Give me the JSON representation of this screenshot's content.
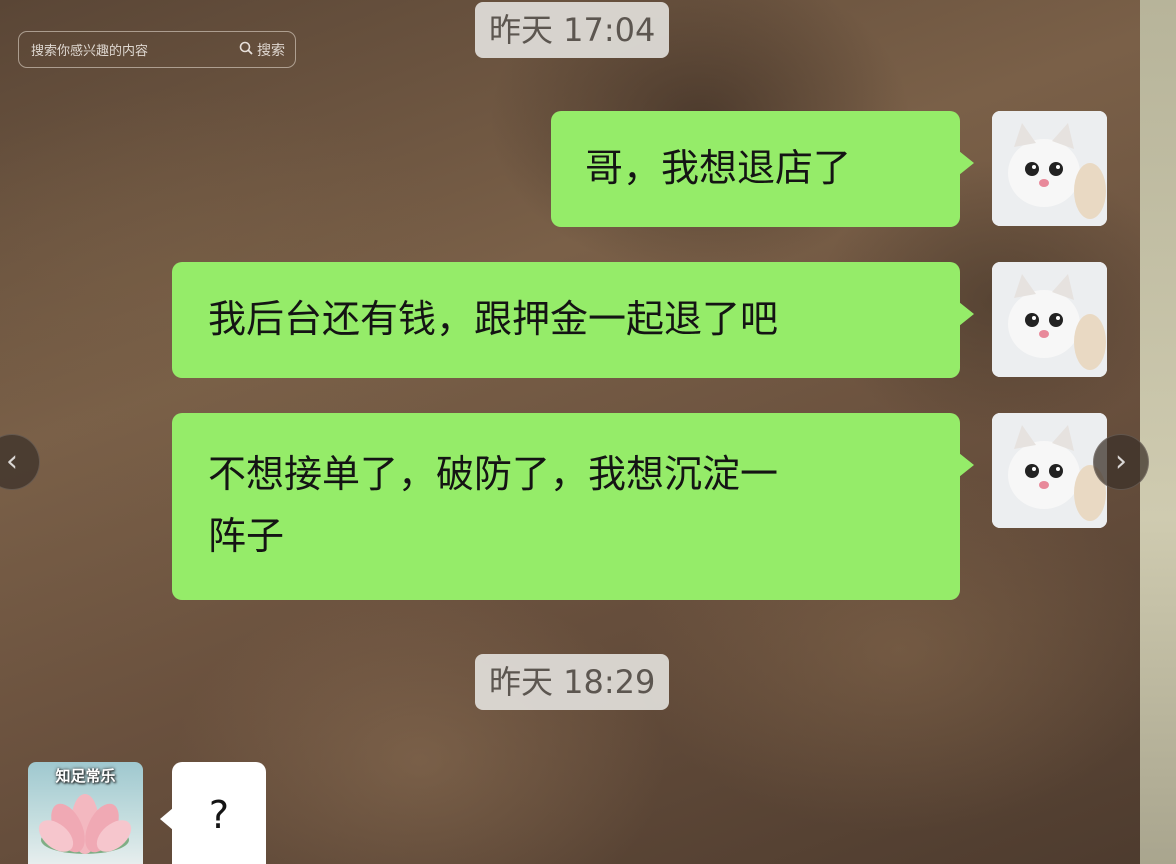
{
  "search": {
    "placeholder": "搜索你感兴趣的内容",
    "button_label": "搜索"
  },
  "timestamps": [
    "昨天 17:04",
    "昨天 18:29"
  ],
  "messages": [
    {
      "sender": "self",
      "text": "哥，我想退店了"
    },
    {
      "sender": "self",
      "text": "我后台还有钱，跟押金一起退了吧"
    },
    {
      "sender": "self",
      "line1": "不想接单了，破防了，我想沉淀一",
      "line2": "阵子"
    },
    {
      "sender": "other",
      "text": "?"
    }
  ],
  "avatars": {
    "self_icon": "kitten-avatar",
    "other_caption": "知足常乐",
    "other_icon": "lotus-avatar"
  },
  "nav": {
    "prev_icon": "chevron-left-icon",
    "next_icon": "chevron-right-icon"
  },
  "colors": {
    "outgoing_bubble": "#95ec69",
    "incoming_bubble": "#ffffff",
    "timestamp_bg": "#e1ded9"
  }
}
